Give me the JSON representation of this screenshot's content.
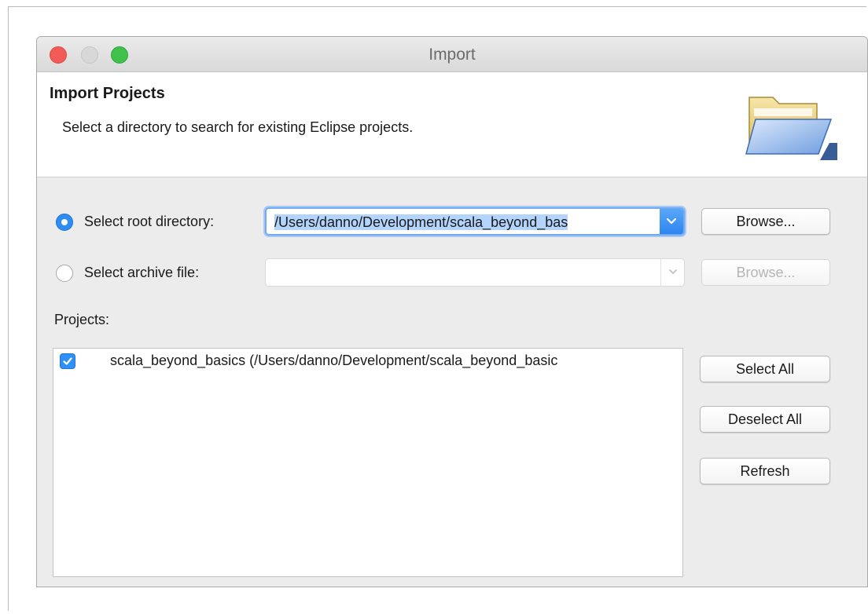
{
  "window": {
    "title": "Import"
  },
  "header": {
    "title": "Import Projects",
    "description": "Select a directory to search for existing Eclipse projects.",
    "icon": "folder-open-icon"
  },
  "source": {
    "root_directory": {
      "label": "Select root directory:",
      "selected": true,
      "value": "/Users/danno/Development/scala_beyond_bas",
      "browse_label": "Browse..."
    },
    "archive_file": {
      "label": "Select archive file:",
      "selected": false,
      "value": "",
      "browse_label": "Browse..."
    }
  },
  "projects": {
    "label": "Projects:",
    "items": [
      {
        "checked": true,
        "label": "scala_beyond_basics (/Users/danno/Development/scala_beyond_basic"
      }
    ]
  },
  "actions": {
    "select_all": "Select All",
    "deselect_all": "Deselect All",
    "refresh": "Refresh"
  },
  "colors": {
    "accent": "#2f8cf3",
    "close": "#f25b56",
    "zoom": "#3fc14b"
  }
}
